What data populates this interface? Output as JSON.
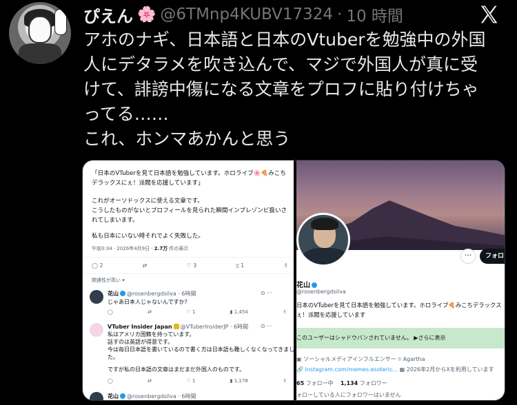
{
  "post": {
    "display_name": "ぴえん",
    "name_emoji": "🌸",
    "handle": "@6TMnp4KUBV17324",
    "separator": "·",
    "time": "10 時間",
    "text_lines": [
      "アホのナギ、日本語と日本のVtuberを勉強中の外国",
      "人にデタラメを吹き込んで、マジで外国人が真に受",
      "けて、誹謗中傷になる文章をプロフに貼り付けちゃ",
      "ってる……",
      "これ、ホンマあかんと思う"
    ]
  },
  "left_screenshot": {
    "body_lines": [
      "「日本のVTuberを見て日本語を勉強しています。ホロライブ🌸🍕みこち",
      "デラックスにぇ！派閥を応援しています」",
      "",
      "これがオーソドックスに使える文章です。",
      "こうしたものがないとプロフィールを見られた瞬間インプレゾンビ扱いさ",
      "れてしまいます。",
      "",
      "私も日本にいない時それでよく失敗した。"
    ],
    "meta_time": "午前0:34 · 2026年4月9日 · ",
    "meta_views": "2.7万",
    "meta_views_label": " 件の表示",
    "actions": {
      "replies": "2",
      "retweets": "",
      "likes": "3",
      "bookmarks": "1"
    },
    "relevance_label": "関連性が高い ▾",
    "replies": [
      {
        "name": "花山",
        "handle": "@rosenbergdsilva · 6時間",
        "lines": [
          "じゃあ日本人じゃないんですか？"
        ],
        "stats": {
          "replies": "",
          "retweets": "",
          "likes": "1",
          "views": "1,454"
        }
      },
      {
        "name": "VTuber Insider Japan",
        "handle": "@VTuberInsiderJP · 6時間",
        "lines": [
          "私はアメリカ国籍を持っています。",
          "話すのは英語が得意です。",
          "今は毎日日本語を書いているので書く方は日本語も難しくなくなってきまし",
          "た。",
          "",
          "ですが私の日本語の文章はまだまだ外国人のものです。"
        ],
        "stats": {
          "replies": "",
          "retweets": "",
          "likes": "1",
          "views": "1,178"
        }
      },
      {
        "name": "花山",
        "handle": "@rosenbergdsilva · 6時間",
        "lines": [],
        "stats": {}
      }
    ]
  },
  "right_screenshot": {
    "more_label": "···",
    "follow_label": "フォロ",
    "name": "花山",
    "handle": "@rosenbergdsilva",
    "bio_lines": [
      "日本のVTuberを見て日本語を勉強しています。ホロライブ🍕みこちデラックス",
      "ぇ！派閥を応援しています"
    ],
    "shadowban_notice": "このユーザーはシャドウバンされていません。 ▶さらに表示",
    "category": "ソーシャルメディアインフルエンサー",
    "location": "Agartha",
    "link": "instagram.com/memes.esoteric...",
    "joined": "2026年2月からXを利用しています",
    "following_count": "65",
    "following_label": "フォロー中",
    "followers_count": "1,134",
    "followers_label": "フォロワー",
    "known_followers": "ォローしている人にフォロワーはいません"
  },
  "colors": {
    "accent": "#1d9bf0",
    "muted": "#71767b",
    "background": "#000000"
  }
}
